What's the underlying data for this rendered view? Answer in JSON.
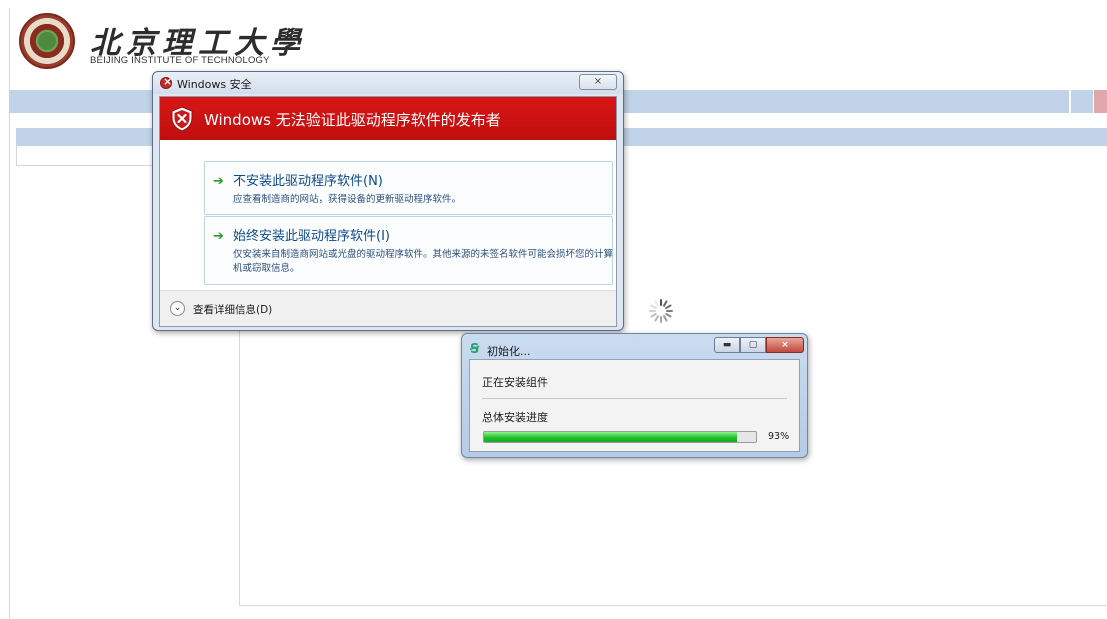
{
  "header": {
    "university_name_cn": "北京理工大學",
    "university_name_en": "BEIJING INSTITUTE OF TECHNOLOGY"
  },
  "security_dialog": {
    "title": "Windows 安全",
    "close_label": "⨯",
    "header_text": "Windows 无法验证此驱动程序软件的发布者",
    "options": [
      {
        "title": "不安装此驱动程序软件(N)",
        "description": "应查看制造商的网站，获得设备的更新驱动程序软件。"
      },
      {
        "title": "始终安装此驱动程序软件(I)",
        "description": "仅安装来自制造商网站或光盘的驱动程序软件。其他来源的未签名软件可能会损坏您的计算机或窃取信息。"
      }
    ],
    "details_label": "查看详细信息(D)"
  },
  "init_window": {
    "title": "初始化...",
    "status_text": "正在安装组件",
    "progress_label": "总体安装进度",
    "progress_percent": 93,
    "progress_text": "93%"
  },
  "colors": {
    "header_red": "#d91616",
    "band_blue": "#c1d3e8",
    "progress_green": "#22c22c",
    "option_title_blue": "#0d4a8c"
  },
  "icons": {
    "logo": "university-emblem",
    "dialog_title": "security-shield-icon",
    "header": "shield-x-icon",
    "option": "green-arrow-icon",
    "details": "chevron-down-icon",
    "init": "installer-icon",
    "loading": "spinner-icon"
  }
}
